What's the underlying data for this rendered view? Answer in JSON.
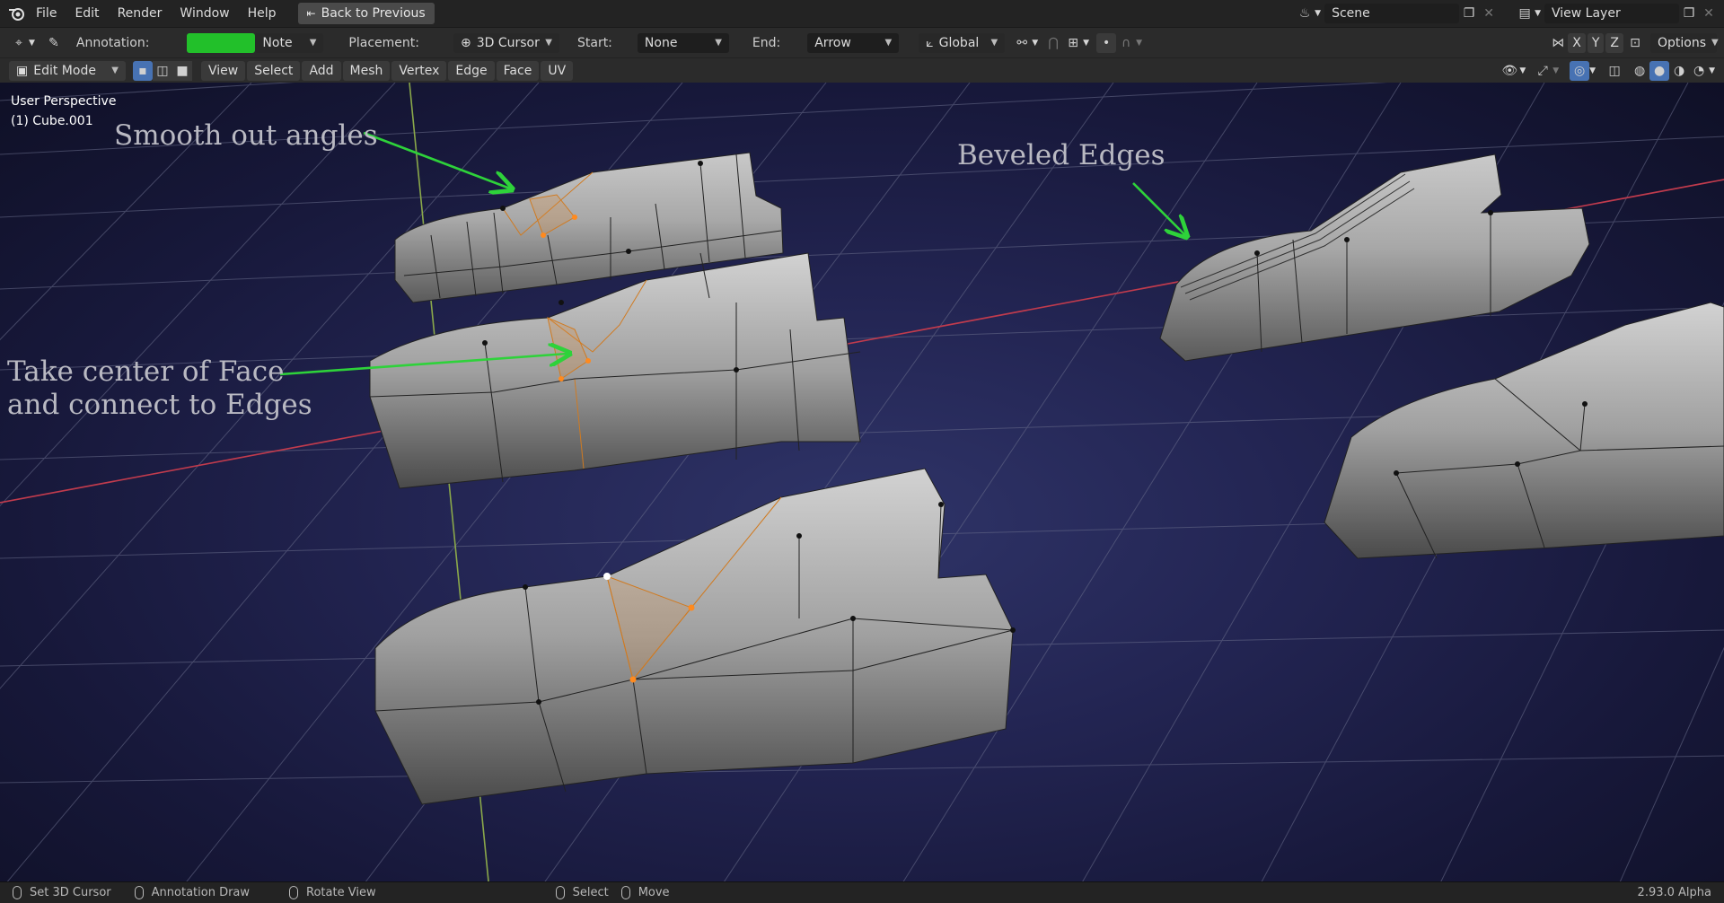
{
  "topbar": {
    "menus": [
      "File",
      "Edit",
      "Render",
      "Window",
      "Help"
    ],
    "back_button": "Back to Previous",
    "scene": "Scene",
    "view_layer": "View Layer"
  },
  "toolbar": {
    "annotation_label": "Annotation:",
    "annotation_color": "#22c02a",
    "note_value": "Note",
    "placement_label": "Placement:",
    "placement_value": "3D Cursor",
    "start_label": "Start:",
    "start_value": "None",
    "end_label": "End:",
    "end_value": "Arrow",
    "orientation_value": "Global",
    "axis_x": "X",
    "axis_y": "Y",
    "axis_z": "Z",
    "options_label": "Options"
  },
  "header": {
    "mode": "Edit Mode",
    "menus": [
      "View",
      "Select",
      "Add",
      "Mesh",
      "Vertex",
      "Edge",
      "Face",
      "UV"
    ]
  },
  "viewport": {
    "perspective": "User Perspective",
    "object": "(1) Cube.001",
    "annotations": {
      "smooth": "Smooth out angles",
      "beveled": "Beveled Edges",
      "center_line1": "Take center of Face",
      "center_line2": "and connect to Edges"
    }
  },
  "statusbar": {
    "items": [
      "Set 3D Cursor",
      "Annotation Draw",
      "Rotate View",
      "Select",
      "Move"
    ],
    "version": "2.93.0 Alpha"
  }
}
